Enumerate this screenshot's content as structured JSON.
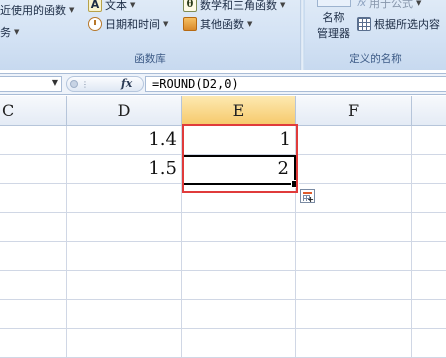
{
  "ribbon": {
    "groups": [
      {
        "label": "函数库",
        "items": [
          {
            "label": "近使用的函数",
            "icon": "recent-functions-icon"
          },
          {
            "label": "务",
            "icon": "financial-icon"
          },
          {
            "label": "文本",
            "icon": "text-icon"
          },
          {
            "label": "日期和时间",
            "icon": "clock-icon"
          },
          {
            "label": "数学和三角函数",
            "icon": "theta-icon"
          },
          {
            "label": "其他函数",
            "icon": "more-functions-icon"
          }
        ]
      },
      {
        "label": "定义的名称",
        "items": [
          {
            "label": "名称",
            "icon": "name-manager-icon"
          },
          {
            "label": "管理器",
            "icon": ""
          },
          {
            "label": "用于公式",
            "icon": "use-in-formula-icon"
          },
          {
            "label": "根据所选内容",
            "icon": "create-from-selection-icon"
          }
        ]
      }
    ]
  },
  "formula_bar": {
    "name_box": "",
    "fx_label": "fx",
    "formula": "=ROUND(D2,0)"
  },
  "grid": {
    "columns": [
      "C",
      "D",
      "E",
      "F"
    ],
    "selected_column": "E",
    "rows": [
      {
        "D": "1.4",
        "E": "1"
      },
      {
        "D": "1.5",
        "E": "2"
      }
    ],
    "active_cell": "E3"
  },
  "colors": {
    "highlight_border": "#e03b3b",
    "selected_header": "#f6c96b",
    "ribbon_bg": "#d3e2f4"
  }
}
